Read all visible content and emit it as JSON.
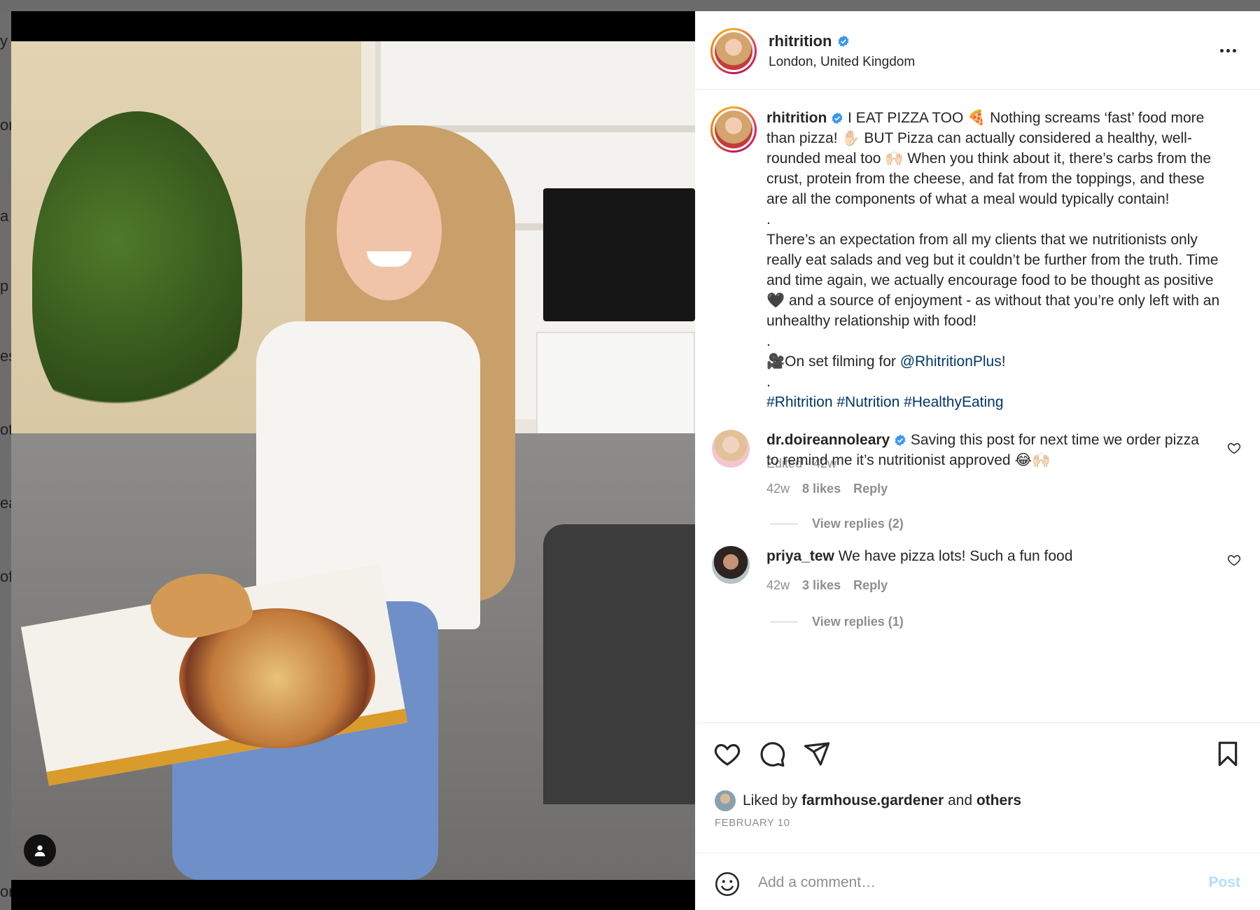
{
  "post": {
    "username": "rhitrition",
    "location": "London, United Kingdom",
    "caption": {
      "username": "rhitrition",
      "paragraph1": "I EAT PIZZA TOO 🍕 Nothing screams ‘fast’ food more than pizza! ✋🏻 BUT Pizza can actually considered a healthy, well-rounded meal too 🙌🏻 When you think about it, there’s carbs from the crust, protein from the cheese, and fat from the toppings, and these are all the components of what a meal would typically contain!",
      "dot1": ".",
      "paragraph2": "There’s an expectation from all my clients that we nutritionists only really eat salads and veg but it couldn’t be further from the truth. Time and time again, we actually encourage food to be thought as positive 🖤 and a source of enjoyment - as without that you’re only left with an unhealthy relationship with food!",
      "dot2": ".",
      "filming_prefix": "🎥On set filming for ",
      "mention": "@RhitritionPlus",
      "filming_suffix": "!",
      "dot3": ".",
      "hashtags": "#Rhitrition #Nutrition #HealthyEating",
      "meta": "Edited · 42w"
    },
    "comments": [
      {
        "username": "dr.doireannoleary",
        "text": "Saving this post for next time we order pizza to remind me it’s nutritionist approved 😂🙌🏻",
        "time": "42w",
        "likes": "8 likes",
        "reply": "Reply",
        "view_replies": "View replies (2)",
        "verified": true
      },
      {
        "username": "priya_tew",
        "text": "We have pizza lots! Such a fun food",
        "time": "42w",
        "likes": "3 likes",
        "reply": "Reply",
        "view_replies": "View replies (1)",
        "verified": false
      }
    ],
    "liked_by_prefix": "Liked by ",
    "liked_by_user": "farmhouse.gardener",
    "liked_by_and": " and ",
    "liked_by_others": "others",
    "date": "FEBRUARY 10"
  },
  "comment_box": {
    "placeholder": "Add a comment…",
    "post_label": "Post"
  },
  "icons": {
    "more": "more-options-icon",
    "like": "heart-icon",
    "comment": "comment-icon",
    "share": "share-icon",
    "save": "bookmark-icon",
    "emoji": "emoji-icon",
    "verified": "verified-badge-icon",
    "user_tag": "user-tag-icon"
  },
  "colors": {
    "link": "#00376b",
    "verified": "#3897f0",
    "post_disabled": "#b2dffc",
    "muted": "#8e8e8e"
  },
  "backdrop_letters": [
    "y",
    "on",
    "a",
    "p",
    "es",
    "oti",
    "ea",
    "of",
    "or"
  ]
}
